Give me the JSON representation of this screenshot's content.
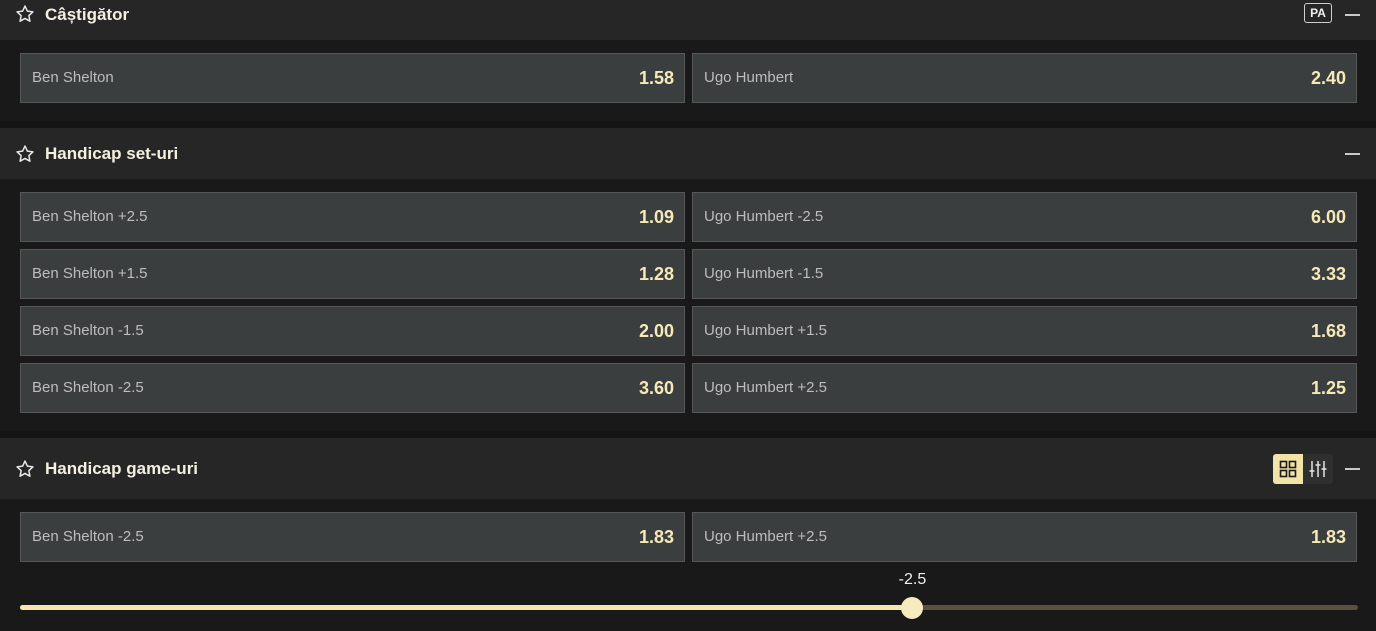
{
  "winner": {
    "title": "Câștigător",
    "badge": "PA",
    "odds": [
      {
        "label": "Ben Shelton",
        "price": "1.58"
      },
      {
        "label": "Ugo Humbert",
        "price": "2.40"
      }
    ]
  },
  "set_handicap": {
    "title": "Handicap set-uri",
    "rows": [
      [
        {
          "label": "Ben Shelton +2.5",
          "price": "1.09"
        },
        {
          "label": "Ugo Humbert -2.5",
          "price": "6.00"
        }
      ],
      [
        {
          "label": "Ben Shelton +1.5",
          "price": "1.28"
        },
        {
          "label": "Ugo Humbert -1.5",
          "price": "3.33"
        }
      ],
      [
        {
          "label": "Ben Shelton -1.5",
          "price": "2.00"
        },
        {
          "label": "Ugo Humbert +1.5",
          "price": "1.68"
        }
      ],
      [
        {
          "label": "Ben Shelton -2.5",
          "price": "3.60"
        },
        {
          "label": "Ugo Humbert +2.5",
          "price": "1.25"
        }
      ]
    ]
  },
  "game_handicap": {
    "title": "Handicap game-uri",
    "odds": [
      {
        "label": "Ben Shelton -2.5",
        "price": "1.83"
      },
      {
        "label": "Ugo Humbert +2.5",
        "price": "1.83"
      }
    ],
    "slider": {
      "value_label": "-2.5",
      "fraction": 0.667
    }
  },
  "icons": {
    "favorite": "star-outline-icon",
    "collapse": "minus-icon",
    "grid_view": "grid-icon",
    "slider_view": "sliders-icon"
  },
  "colors": {
    "accent": "#f3e6b0",
    "price": "#f5e9b9",
    "odd_bg": "#3b3e3e",
    "header_bg": "#262626"
  }
}
